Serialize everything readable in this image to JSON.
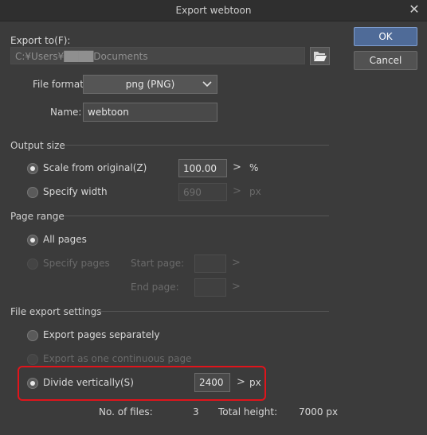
{
  "window": {
    "title": "Export webtoon",
    "close_glyph": "✕"
  },
  "buttons": {
    "ok": "OK",
    "cancel": "Cancel"
  },
  "export_to": {
    "label": "Export to(F):",
    "path": "C:¥Users¥████Documents",
    "folder_icon": "folder-open-icon"
  },
  "file_format": {
    "label": "File format:",
    "value": "png (PNG)"
  },
  "name": {
    "label": "Name:",
    "value": "webtoon"
  },
  "output_size": {
    "title": "Output size",
    "scale": {
      "label": "Scale from original(Z)",
      "value": "100.00",
      "unit": "%",
      "selected": true
    },
    "width": {
      "label": "Specify width",
      "value": "690",
      "unit": "px",
      "selected": false
    }
  },
  "page_range": {
    "title": "Page range",
    "all": {
      "label": "All pages",
      "selected": true
    },
    "specify": {
      "label": "Specify pages",
      "selected": false
    },
    "start_label": "Start page:",
    "end_label": "End page:"
  },
  "file_export": {
    "title": "File export settings",
    "separately": {
      "label": "Export pages separately",
      "selected": false
    },
    "continuous": {
      "label": "Export as one continuous page",
      "selected": false
    },
    "divide": {
      "label": "Divide vertically(S)",
      "value": "2400",
      "unit": "px",
      "selected": true
    }
  },
  "footer": {
    "files_label": "No. of files:",
    "files_value": "3",
    "height_label": "Total height:",
    "height_value": "7000 px"
  }
}
